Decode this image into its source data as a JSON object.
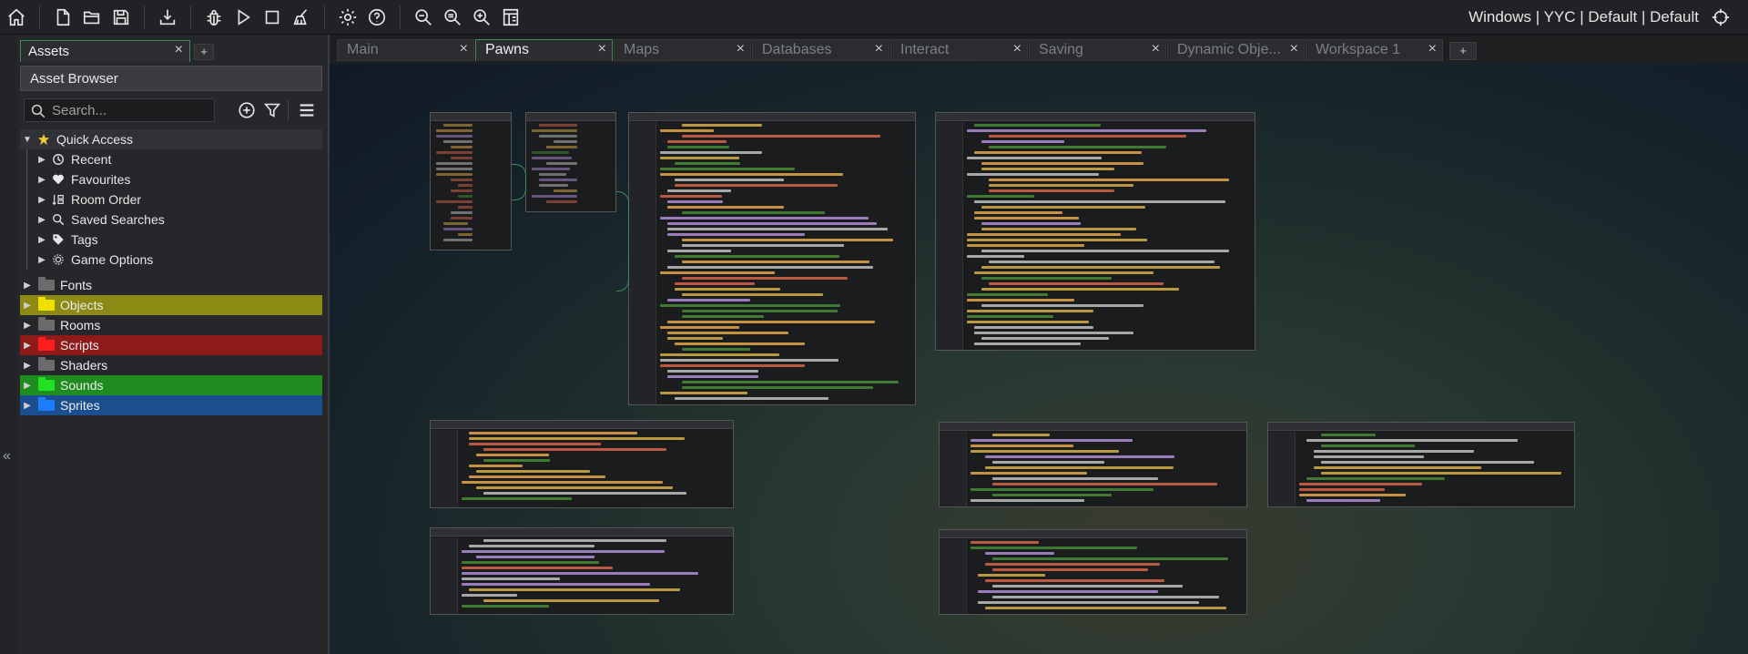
{
  "toolbar": {
    "target_info": "Windows | YYC | Default | Default"
  },
  "asset_panel": {
    "tab_label": "Assets",
    "tab_close": "×",
    "tab_add": "+",
    "browser_title": "Asset Browser",
    "search_placeholder": "Search...",
    "quick_access": {
      "label": "Quick Access",
      "items": [
        {
          "label": "Recent",
          "icon": "clock-icon"
        },
        {
          "label": "Favourites",
          "icon": "heart-icon"
        },
        {
          "label": "Room Order",
          "icon": "room-order-icon"
        },
        {
          "label": "Saved Searches",
          "icon": "search-icon"
        },
        {
          "label": "Tags",
          "icon": "tag-icon"
        },
        {
          "label": "Game Options",
          "icon": "gear-icon"
        }
      ]
    },
    "folders": [
      {
        "label": "Fonts",
        "color": "",
        "icon_color": "#6b6b6b"
      },
      {
        "label": "Objects",
        "color": "#8c8a14",
        "icon_color": "#f0e000"
      },
      {
        "label": "Rooms",
        "color": "",
        "icon_color": "#6b6b6b"
      },
      {
        "label": "Scripts",
        "color": "#8e1a1a",
        "icon_color": "#ff1e1e"
      },
      {
        "label": "Shaders",
        "color": "",
        "icon_color": "#6b6b6b"
      },
      {
        "label": "Sounds",
        "color": "#1e8c1e",
        "icon_color": "#22e022"
      },
      {
        "label": "Sprites",
        "color": "#1a4e8e",
        "icon_color": "#1e7cff"
      }
    ]
  },
  "editor": {
    "tabs": [
      {
        "label": "Main",
        "active": false
      },
      {
        "label": "Pawns",
        "active": true
      },
      {
        "label": "Maps",
        "active": false
      },
      {
        "label": "Databases",
        "active": false
      },
      {
        "label": "Interact",
        "active": false
      },
      {
        "label": "Saving",
        "active": false
      },
      {
        "label": "Dynamic Obje...",
        "active": false
      },
      {
        "label": "Workspace 1",
        "active": false
      }
    ],
    "tab_close": "×",
    "tab_add": "+"
  },
  "colors": {
    "accent": "#3f8a58",
    "code_keyword": "#f0c14b",
    "code_string": "#f26c4f",
    "code_comment": "#4e9a3a",
    "code_func": "#ffb84f",
    "code_var": "#c59cf2",
    "code_plain": "#d6d6d6"
  }
}
